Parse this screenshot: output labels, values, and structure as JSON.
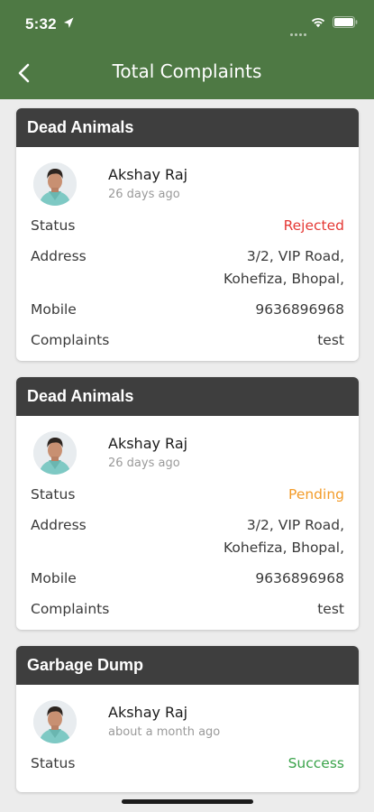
{
  "status_bar": {
    "time": "5:32"
  },
  "header": {
    "title": "Total Complaints"
  },
  "labels": {
    "status": "Status",
    "address": "Address",
    "mobile": "Mobile",
    "complaints": "Complaints"
  },
  "complaints": [
    {
      "category": "Dead Animals",
      "user": "Akshay Raj",
      "time_ago": "26 days ago",
      "status": "Rejected",
      "status_color": "#e53935",
      "address_line1": "3/2, VIP Road,",
      "address_line2": "Kohefiza, Bhopal,",
      "mobile": "9636896968",
      "complaint": "test"
    },
    {
      "category": "Dead Animals",
      "user": "Akshay Raj",
      "time_ago": "26 days ago",
      "status": "Pending",
      "status_color": "#f39c2a",
      "address_line1": "3/2, VIP Road,",
      "address_line2": "Kohefiza, Bhopal,",
      "mobile": "9636896968",
      "complaint": "test"
    },
    {
      "category": "Garbage Dump",
      "user": "Akshay Raj",
      "time_ago": "about a month ago",
      "status": "Success",
      "status_color": "#3aa34a"
    }
  ],
  "colors": {
    "header_bg": "#4e7944",
    "card_header_bg": "#3e3e3e",
    "page_bg": "#ececec"
  },
  "icons": {
    "back": "back-arrow-icon",
    "location": "location-arrow-icon",
    "wifi": "wifi-icon",
    "battery": "battery-icon"
  }
}
